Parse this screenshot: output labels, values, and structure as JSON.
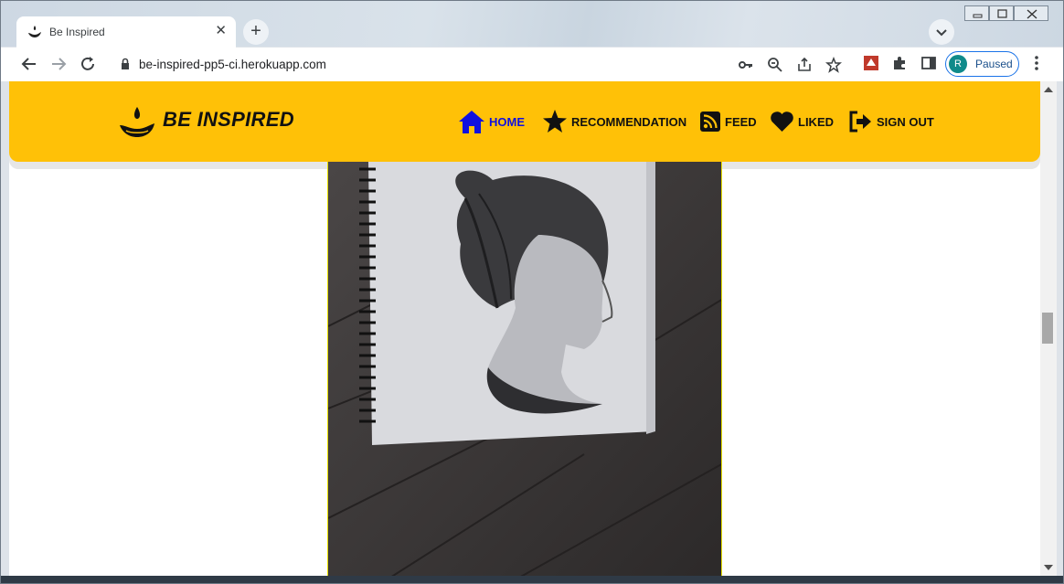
{
  "browser": {
    "tab": {
      "title": "Be Inspired",
      "close": "✕"
    },
    "new_tab": "+",
    "url": "be-inspired-pp5-ci.herokuapp.com",
    "profile": {
      "initial": "R",
      "status": "Paused"
    }
  },
  "site": {
    "brand": "BE INSPIRED",
    "nav": [
      {
        "label": "HOME",
        "icon": "home-icon",
        "active": true
      },
      {
        "label": "RECOMMENDATION",
        "icon": "star-icon",
        "active": false
      },
      {
        "label": "FEED",
        "icon": "rss-icon",
        "active": false
      },
      {
        "label": "LIKED",
        "icon": "heart-icon",
        "active": false
      },
      {
        "label": "SIGN OUT",
        "icon": "sign-out-icon",
        "active": false
      }
    ],
    "colors": {
      "navbar": "#ffc107",
      "active_link": "#1010e0"
    }
  }
}
